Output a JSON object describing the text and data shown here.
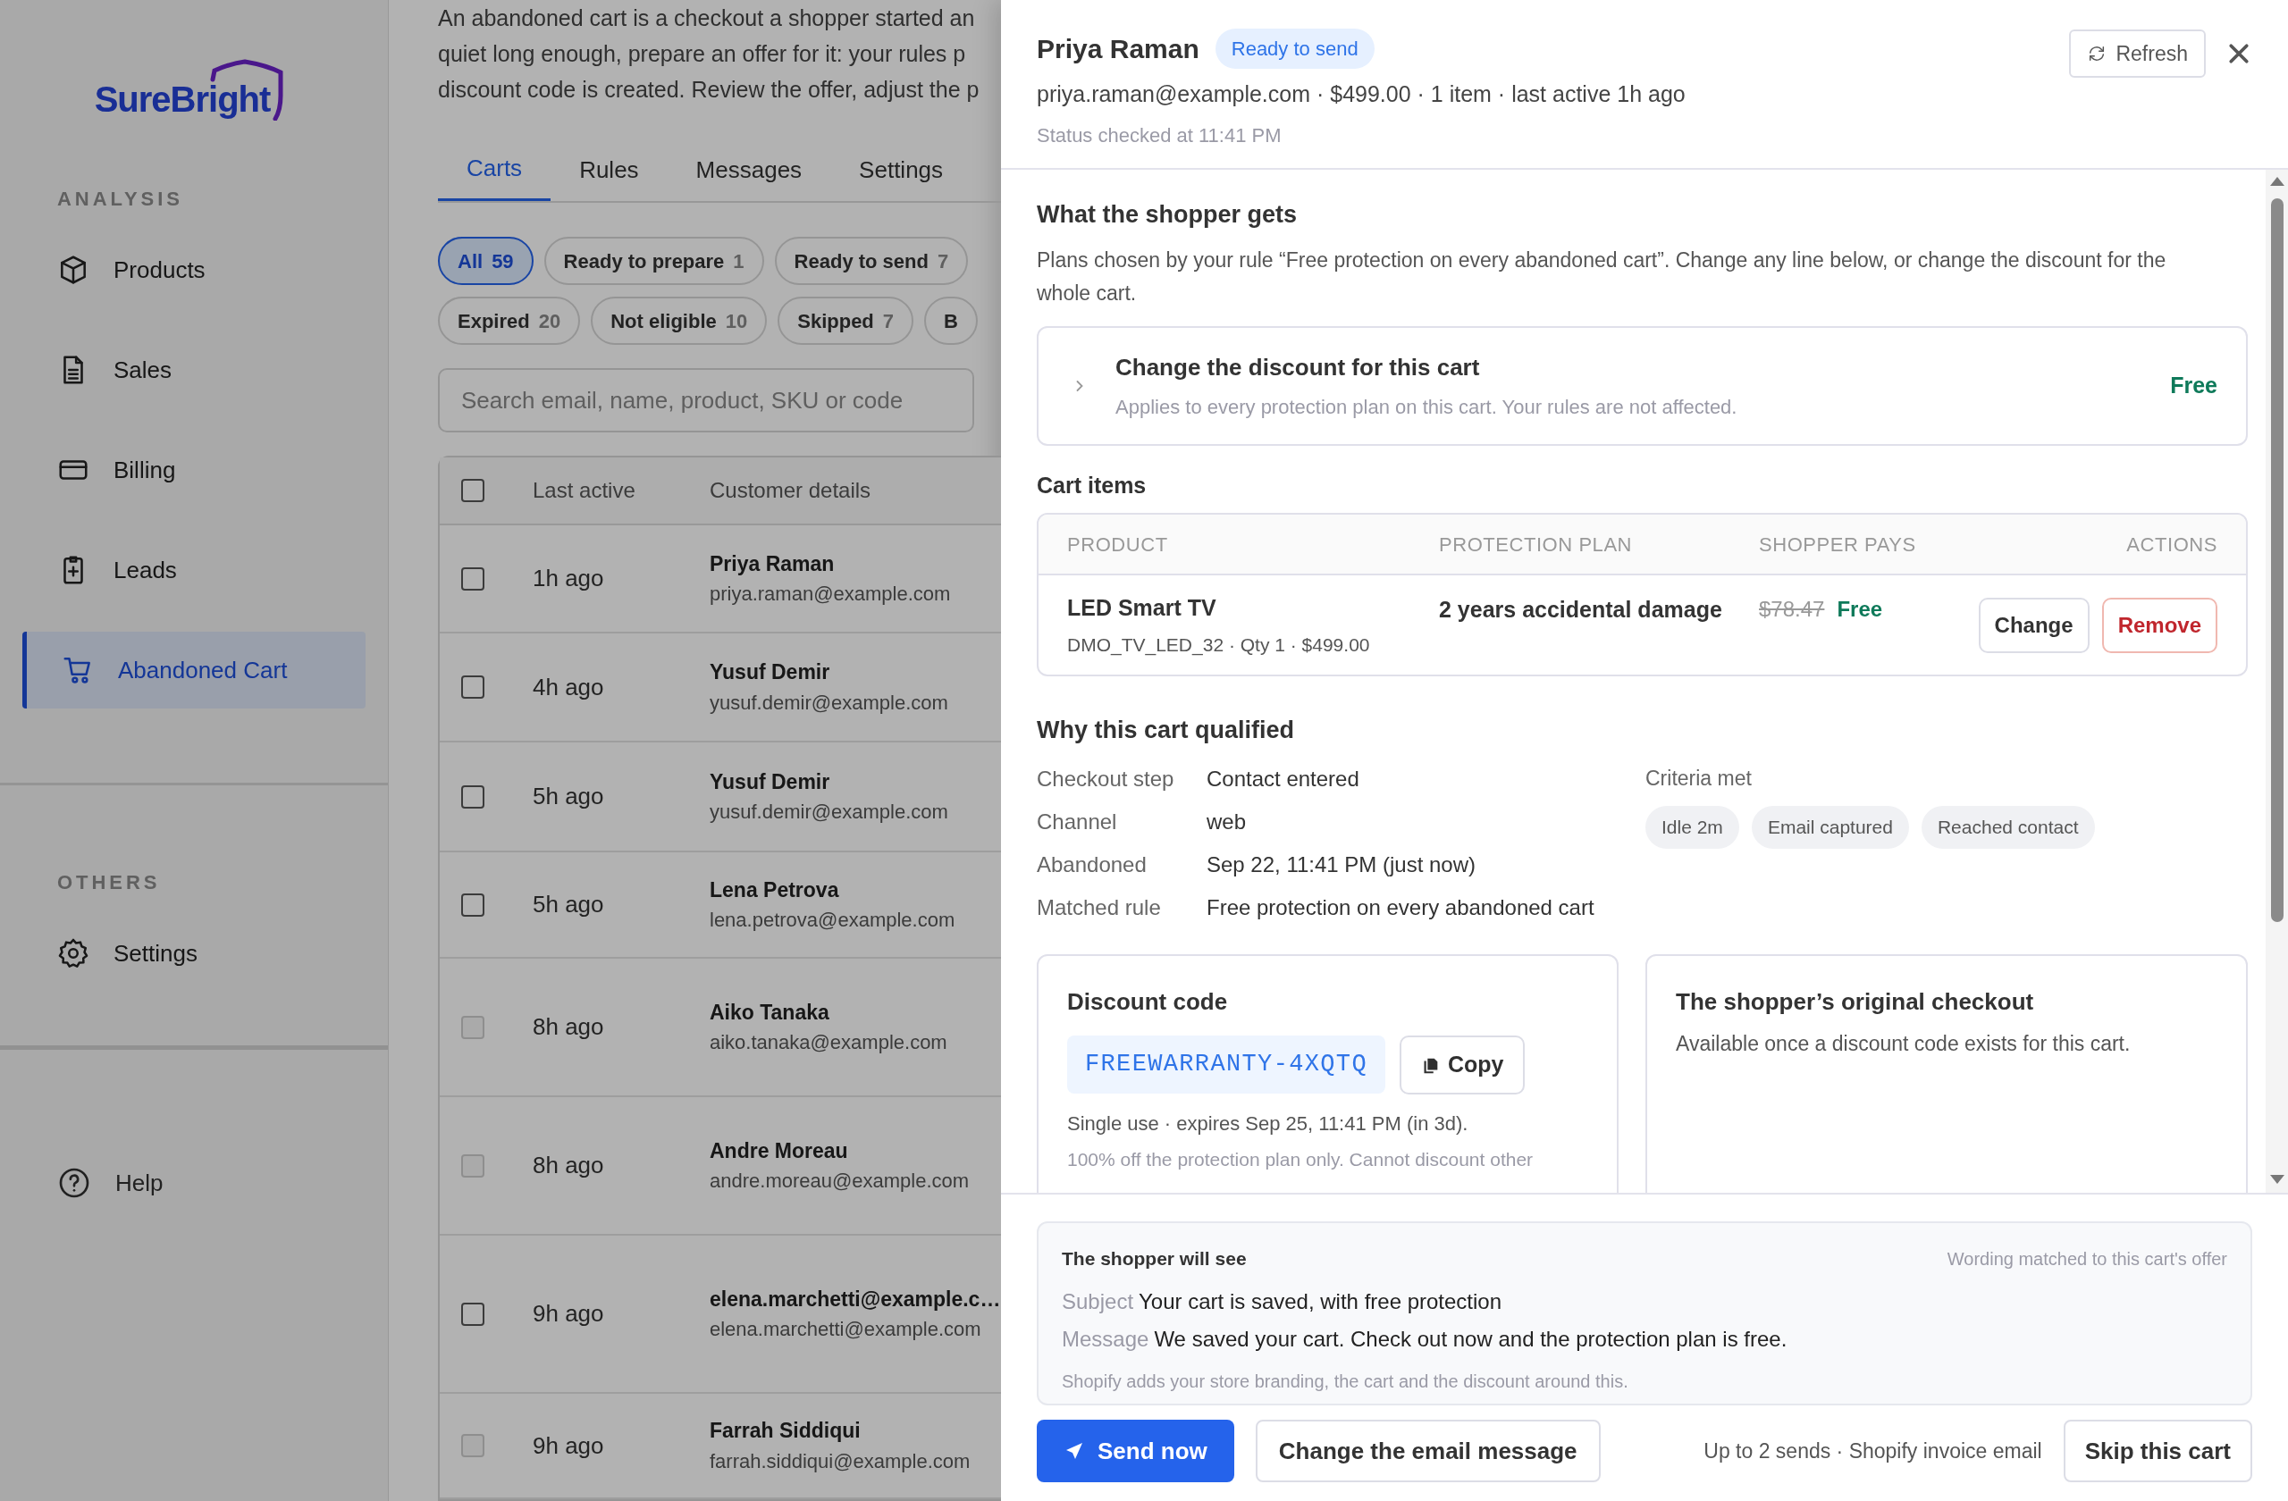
{
  "sidebar": {
    "logo": "SureBright",
    "sections": [
      {
        "heading": "ANALYSIS",
        "items": [
          {
            "label": "Products",
            "selected": false
          },
          {
            "label": "Sales",
            "selected": false
          },
          {
            "label": "Billing",
            "selected": false
          },
          {
            "label": "Leads",
            "selected": false
          },
          {
            "label": "Abandoned Cart",
            "selected": true
          }
        ]
      },
      {
        "heading": "OTHERS",
        "items": [
          {
            "label": "Settings",
            "selected": false
          }
        ]
      }
    ],
    "footer_item": {
      "label": "Help"
    }
  },
  "page": {
    "description_lines": [
      "An abandoned cart is a checkout a shopper started an",
      "quiet long enough, prepare an offer for it: your rules p",
      "discount code is created. Review the offer, adjust the p"
    ],
    "tabs": [
      {
        "label": "Carts",
        "selected": true
      },
      {
        "label": "Rules",
        "selected": false
      },
      {
        "label": "Messages",
        "selected": false
      },
      {
        "label": "Settings",
        "selected": false
      }
    ],
    "filter_rows": [
      [
        {
          "label": "All",
          "count": "59",
          "selected": true
        },
        {
          "label": "Ready to prepare",
          "count": "1",
          "selected": false
        },
        {
          "label": "Ready to send",
          "count": "7",
          "selected": false
        }
      ],
      [
        {
          "label": "Expired",
          "count": "20",
          "selected": false
        },
        {
          "label": "Not eligible",
          "count": "10",
          "selected": false
        },
        {
          "label": "Skipped",
          "count": "7",
          "selected": false
        },
        {
          "label": "B",
          "selected": false
        }
      ]
    ],
    "search": {
      "placeholder": "Search email, name, product, SKU or code"
    },
    "table": {
      "header_checked": false,
      "columns": [
        "Last active",
        "Customer details"
      ],
      "rows": [
        {
          "last_active": "1h ago",
          "name": "Priya Raman",
          "email": "priya.raman@example.com",
          "checked": false,
          "disabled": false
        },
        {
          "last_active": "4h ago",
          "name": "Yusuf Demir",
          "email": "yusuf.demir@example.com",
          "checked": false,
          "disabled": false
        },
        {
          "last_active": "5h ago",
          "name": "Yusuf Demir",
          "email": "yusuf.demir@example.com",
          "checked": false,
          "disabled": false
        },
        {
          "last_active": "5h ago",
          "name": "Lena Petrova",
          "email": "lena.petrova@example.com",
          "checked": false,
          "disabled": false
        },
        {
          "last_active": "8h ago",
          "name": "Aiko Tanaka",
          "email": "aiko.tanaka@example.com",
          "checked": false,
          "disabled": true
        },
        {
          "last_active": "8h ago",
          "name": "Andre Moreau",
          "email": "andre.moreau@example.com",
          "checked": false,
          "disabled": true
        },
        {
          "last_active": "9h ago",
          "name": "elena.marchetti@example.c…",
          "email": "elena.marchetti@example.com",
          "checked": false,
          "disabled": false
        },
        {
          "last_active": "9h ago",
          "name": "Farrah Siddiqui",
          "email": "farrah.siddiqui@example.com",
          "checked": false,
          "disabled": true
        }
      ]
    }
  },
  "drawer": {
    "title": "Priya Raman",
    "status": "Ready to send",
    "meta": "priya.raman@example.com · $499.00 · 1 item · last active 1h ago",
    "checked_at": "Status checked at 11:41 PM",
    "refresh": "Refresh",
    "offer": {
      "heading": "What the shopper gets",
      "description": "Plans chosen by your rule “Free protection on every abandoned cart”. Change any line below, or change the discount for the whole cart.",
      "override": {
        "title": "Change the discount for this cart",
        "note": "Applies to every protection plan on this cart. Your rules are not affected.",
        "value": "Free",
        "expanded": false
      }
    },
    "cart_items": {
      "heading": "Cart items",
      "columns": [
        "PRODUCT",
        "PROTECTION PLAN",
        "SHOPPER PAYS",
        "ACTIONS"
      ],
      "rows": [
        {
          "product": "LED Smart TV",
          "detail": "DMO_TV_LED_32 · Qty 1 · $499.00",
          "plan": "2 years accidental damage",
          "original_price": "$78.47",
          "price": "Free",
          "actions": [
            {
              "label": "Change",
              "kind": "default"
            },
            {
              "label": "Remove",
              "kind": "danger"
            }
          ]
        }
      ]
    },
    "qualified": {
      "heading": "Why this cart qualified",
      "facts": [
        {
          "label": "Checkout step",
          "value": "Contact entered"
        },
        {
          "label": "Channel",
          "value": "web"
        },
        {
          "label": "Abandoned",
          "value": "Sep 22, 11:41 PM (just now)"
        },
        {
          "label": "Matched rule",
          "value": "Free protection on every abandoned cart"
        }
      ],
      "criteria_label": "Criteria met",
      "criteria": [
        "Idle 2m",
        "Email captured",
        "Reached contact"
      ]
    },
    "discount_code": {
      "heading": "Discount code",
      "code": "FREEWARRANTY-4XQTQ",
      "copy": "Copy",
      "usage": "Single use · expires Sep 25, 11:41 PM (in 3d).",
      "note": "100% off the protection plan only. Cannot discount other"
    },
    "original_checkout": {
      "heading": "The shopper’s original checkout",
      "note": "Available once a discount code exists for this cart."
    },
    "email_preview": {
      "heading": "The shopper will see",
      "hint": "Wording matched to this cart's offer",
      "fields": [
        {
          "label": "Subject",
          "value": "Your cart is saved, with free protection"
        },
        {
          "label": "Message",
          "value": "We saved your cart. Check out now and the protection plan is free."
        }
      ],
      "footnote": "Shopify adds your store branding, the cart and the discount around this."
    },
    "footer": {
      "send": "Send now",
      "change": "Change the email message",
      "info": "Up to 2 sends · Shopify invoice email",
      "skip": "Skip this cart"
    }
  }
}
